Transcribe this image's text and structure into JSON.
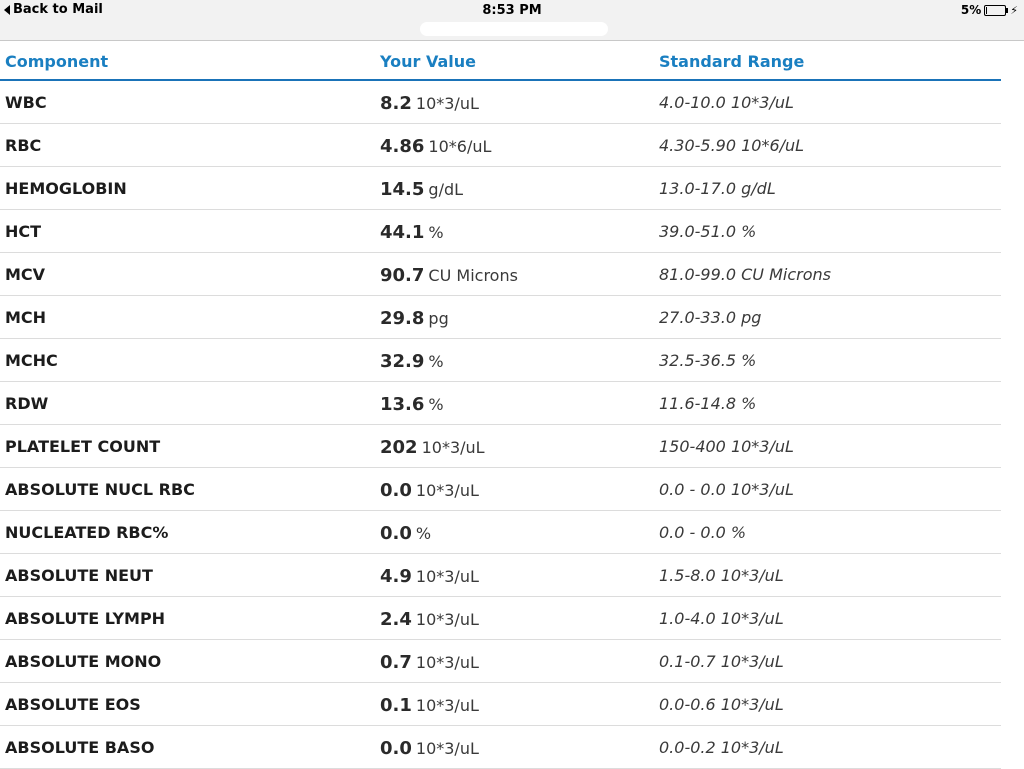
{
  "statusbar": {
    "back_label": "Back to Mail",
    "time": "8:53 PM",
    "battery_percent": "5%",
    "battery_level": 0.05
  },
  "table": {
    "headers": {
      "component": "Component",
      "value": "Your Value",
      "range": "Standard Range"
    },
    "rows": [
      {
        "component": "WBC",
        "value": "8.2",
        "unit": "10*3/uL",
        "range": "4.0-10.0 10*3/uL"
      },
      {
        "component": "RBC",
        "value": "4.86",
        "unit": "10*6/uL",
        "range": "4.30-5.90 10*6/uL"
      },
      {
        "component": "HEMOGLOBIN",
        "value": "14.5",
        "unit": "g/dL",
        "range": "13.0-17.0 g/dL"
      },
      {
        "component": "HCT",
        "value": "44.1",
        "unit": "%",
        "range": "39.0-51.0 %"
      },
      {
        "component": "MCV",
        "value": "90.7",
        "unit": "CU Microns",
        "range": "81.0-99.0 CU Microns"
      },
      {
        "component": "MCH",
        "value": "29.8",
        "unit": "pg",
        "range": "27.0-33.0 pg"
      },
      {
        "component": "MCHC",
        "value": "32.9",
        "unit": "%",
        "range": "32.5-36.5 %"
      },
      {
        "component": "RDW",
        "value": "13.6",
        "unit": "%",
        "range": "11.6-14.8 %"
      },
      {
        "component": "PLATELET COUNT",
        "value": "202",
        "unit": "10*3/uL",
        "range": "150-400 10*3/uL"
      },
      {
        "component": "ABSOLUTE NUCL RBC",
        "value": "0.0",
        "unit": "10*3/uL",
        "range": "0.0 - 0.0 10*3/uL"
      },
      {
        "component": "NUCLEATED RBC%",
        "value": "0.0",
        "unit": "%",
        "range": "0.0 - 0.0 %"
      },
      {
        "component": "ABSOLUTE NEUT",
        "value": "4.9",
        "unit": "10*3/uL",
        "range": "1.5-8.0 10*3/uL"
      },
      {
        "component": "ABSOLUTE LYMPH",
        "value": "2.4",
        "unit": "10*3/uL",
        "range": "1.0-4.0 10*3/uL"
      },
      {
        "component": "ABSOLUTE MONO",
        "value": "0.7",
        "unit": "10*3/uL",
        "range": "0.1-0.7 10*3/uL"
      },
      {
        "component": "ABSOLUTE EOS",
        "value": "0.1",
        "unit": "10*3/uL",
        "range": "0.0-0.6 10*3/uL"
      },
      {
        "component": "ABSOLUTE BASO",
        "value": "0.0",
        "unit": "10*3/uL",
        "range": "0.0-0.2 10*3/uL"
      }
    ]
  }
}
